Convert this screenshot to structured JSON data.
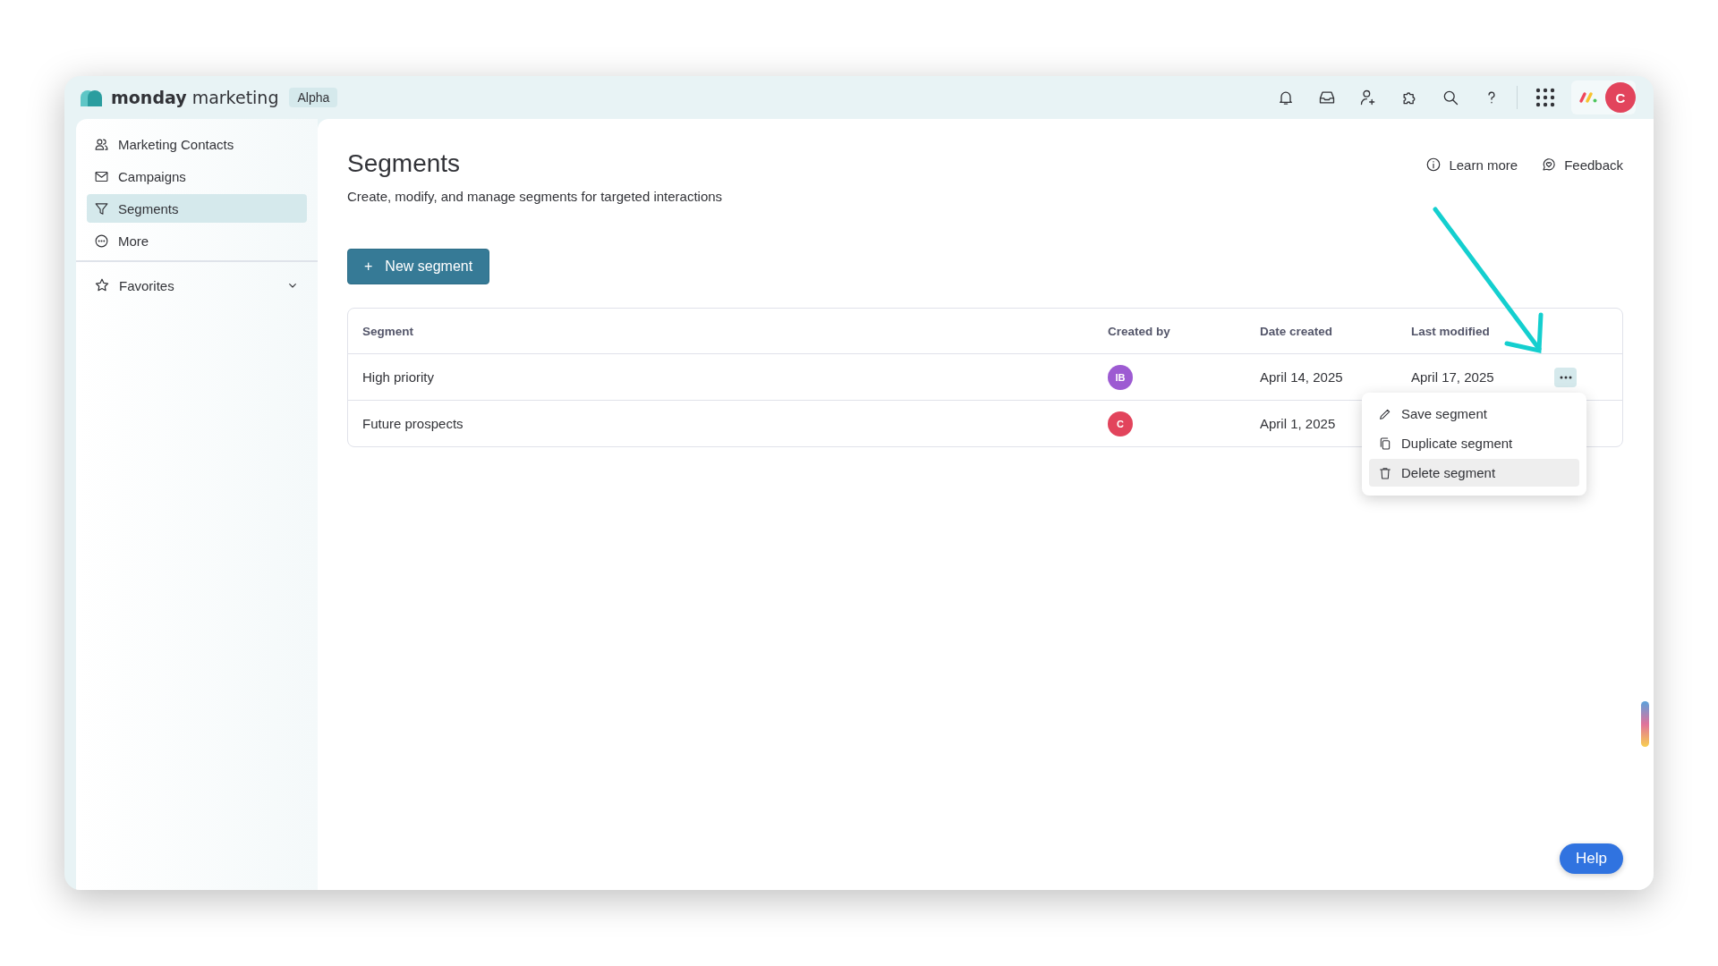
{
  "brand": {
    "name_bold": "monday",
    "name": "marketing",
    "badge": "Alpha"
  },
  "topbar": {
    "avatar": "C"
  },
  "sidebar": {
    "items": [
      {
        "label": "Marketing Contacts",
        "selected": false
      },
      {
        "label": "Campaigns",
        "selected": false
      },
      {
        "label": "Segments",
        "selected": true
      },
      {
        "label": "More",
        "selected": false
      }
    ],
    "favorites": {
      "label": "Favorites",
      "expanded": false
    }
  },
  "page": {
    "title": "Segments",
    "subtitle": "Create, modify, and manage segments for targeted interactions",
    "links": [
      {
        "label": "Learn more"
      },
      {
        "label": "Feedback"
      }
    ],
    "new_button": {
      "icon": "+",
      "label": "New segment"
    }
  },
  "table": {
    "columns": [
      "Segment",
      "Created by",
      "Date created",
      "Last modified"
    ],
    "rows": [
      {
        "segment": "High priority",
        "creator": "IB",
        "color": "#9d5bd2",
        "date_created": "April 14, 2025",
        "last_modified": "April 17, 2025",
        "menu_open": true
      },
      {
        "segment": "Future prospects",
        "creator": "C",
        "color": "#e2445c",
        "date_created": "April 1, 2025",
        "menu_open": false
      }
    ]
  },
  "row_menu": {
    "items": [
      {
        "label": "Save segment",
        "selected": false
      },
      {
        "label": "Duplicate segment",
        "selected": false
      },
      {
        "label": "Delete segment",
        "selected": true
      }
    ]
  },
  "help_button": {
    "label": "Help"
  }
}
